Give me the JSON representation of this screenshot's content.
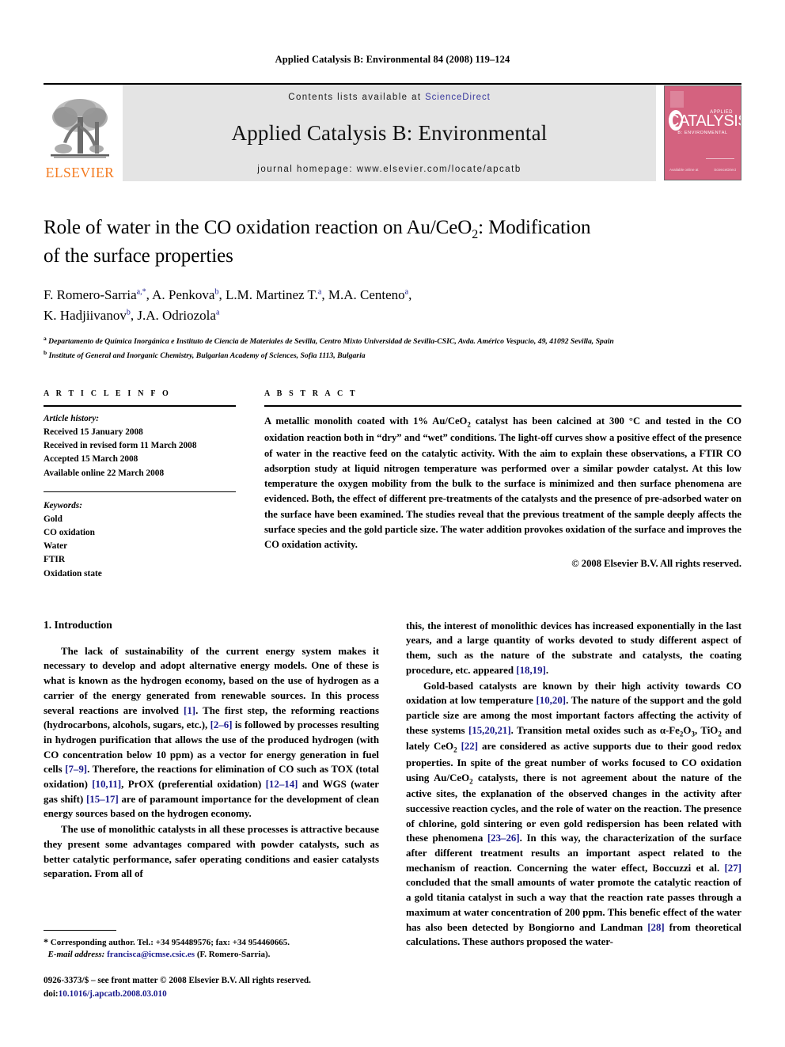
{
  "running_head": "Applied Catalysis B: Environmental 84 (2008) 119–124",
  "masthead": {
    "publisher": "ELSEVIER",
    "contents_prefix": "Contents lists available at",
    "contents_link": "ScienceDirect",
    "journal_title": "Applied Catalysis B: Environmental",
    "homepage_line": "journal homepage: www.elsevier.com/locate/apcatb",
    "cover": {
      "applied": "APPLIED",
      "catalysis": "CATALYSIS",
      "subtitle": "B: ENVIRONMENTAL",
      "footer_left": "Available online at",
      "footer_right": "ScienceDirect",
      "accent_color": "#d4627f"
    },
    "link_color": "#3a3a9e",
    "elsevier_color": "#f47b20"
  },
  "article": {
    "title_line1": "Role of water in the CO oxidation reaction on Au/CeO",
    "title_sub1": "2",
    "title_line1_tail": ": Modification",
    "title_line2": "of the surface properties",
    "authors": "F. Romero-Sarria a,*, A. Penkova b, L.M. Martinez T. a, M.A. Centeno a, K. Hadjiivanov b, J.A. Odriozola a",
    "affiliation_a": "Departamento de Química Inorgánica e Instituto de Ciencia de Materiales de Sevilla, Centro Mixto Universidad de Sevilla-CSIC, Avda. Américo Vespucio, 49, 41092 Sevilla, Spain",
    "affiliation_b": "Institute of General and Inorganic Chemistry, Bulgarian Academy of Sciences, Sofia 1113, Bulgaria"
  },
  "article_info": {
    "heading": "A R T I C L E  I N F O",
    "history_label": "Article history:",
    "history": [
      "Received 15 January 2008",
      "Received in revised form 11 March 2008",
      "Accepted 15 March 2008",
      "Available online 22 March 2008"
    ],
    "keywords_label": "Keywords:",
    "keywords": [
      "Gold",
      "CO oxidation",
      "Water",
      "FTIR",
      "Oxidation state"
    ]
  },
  "abstract": {
    "heading": "A B S T R A C T",
    "text_part1": "A metallic monolith coated with 1% Au/CeO",
    "text_sub": "2",
    "text_part2": " catalyst has been calcined at 300 °C and tested in the CO oxidation reaction both in “dry” and “wet” conditions. The light-off curves show a positive effect of the presence of water in the reactive feed on the catalytic activity. With the aim to explain these observations, a FTIR CO adsorption study at liquid nitrogen temperature was performed over a similar powder catalyst. At this low temperature the oxygen mobility from the bulk to the surface is minimized and then surface phenomena are evidenced. Both, the effect of different pre-treatments of the catalysts and the presence of pre-adsorbed water on the surface have been examined. The studies reveal that the previous treatment of the sample deeply affects the surface species and the gold particle size. The water addition provokes oxidation of the surface and improves the CO oxidation activity.",
    "copyright": "© 2008 Elsevier B.V. All rights reserved."
  },
  "introduction": {
    "heading": "1. Introduction",
    "left_p1": "The lack of sustainability of the current energy system makes it necessary to develop and adopt alternative energy models. One of these is what is known as the hydrogen economy, based on the use of hydrogen as a carrier of the energy generated from renewable sources. In this process several reactions are involved [1]. The first step, the reforming reactions (hydrocarbons, alcohols, sugars, etc.), [2–6] is followed by processes resulting in hydrogen purification that allows the use of the produced hydrogen (with CO concentration below 10 ppm) as a vector for energy generation in fuel cells [7–9]. Therefore, the reactions for elimination of CO such as TOX (total oxidation) [10,11], PrOX (preferential oxidation) [12–14] and WGS (water gas shift) [15–17] are of paramount importance for the development of clean energy sources based on the hydrogen economy.",
    "left_p2": "The use of monolithic catalysts in all these processes is attractive because they present some advantages compared with powder catalysts, such as better catalytic performance, safer operating conditions and easier catalysts separation. From all of",
    "right_p1": "this, the interest of monolithic devices has increased exponentially in the last years, and a large quantity of works devoted to study different aspect of them, such as the nature of the substrate and catalysts, the coating procedure, etc. appeared [18,19].",
    "right_p2": "Gold-based catalysts are known by their high activity towards CO oxidation at low temperature [10,20]. The nature of the support and the gold particle size are among the most important factors affecting the activity of these systems [15,20,21]. Transition metal oxides such as α-Fe2O3, TiO2 and lately CeO2 [22] are considered as active supports due to their good redox properties. In spite of the great number of works focused to CO oxidation using Au/CeO2 catalysts, there is not agreement about the nature of the active sites, the explanation of the observed changes in the activity after successive reaction cycles, and the role of water on the reaction. The presence of chlorine, gold sintering or even gold redispersion has been related with these phenomena [23–26]. In this way, the characterization of the surface after different treatment results an important aspect related to the mechanism of reaction. Concerning the water effect, Boccuzzi et al. [27] concluded that the small amounts of water promote the catalytic reaction of a gold titania catalyst in such a way that the reaction rate passes through a maximum at water concentration of 200 ppm. This benefic effect of the water has also been detected by Bongiorno and Landman [28] from theoretical calculations. These authors proposed the water-"
  },
  "footnote": {
    "star": "*",
    "corresponding": "Corresponding author. Tel.: +34 954489576; fax: +34 954460665.",
    "email_label": "E-mail address:",
    "email": "francisca@icmse.csic.es",
    "email_suffix": "(F. Romero-Sarria).",
    "issn_line": "0926-3373/$ – see front matter © 2008 Elsevier B.V. All rights reserved.",
    "doi_label": "doi:",
    "doi": "10.1016/j.apcatb.2008.03.010"
  }
}
